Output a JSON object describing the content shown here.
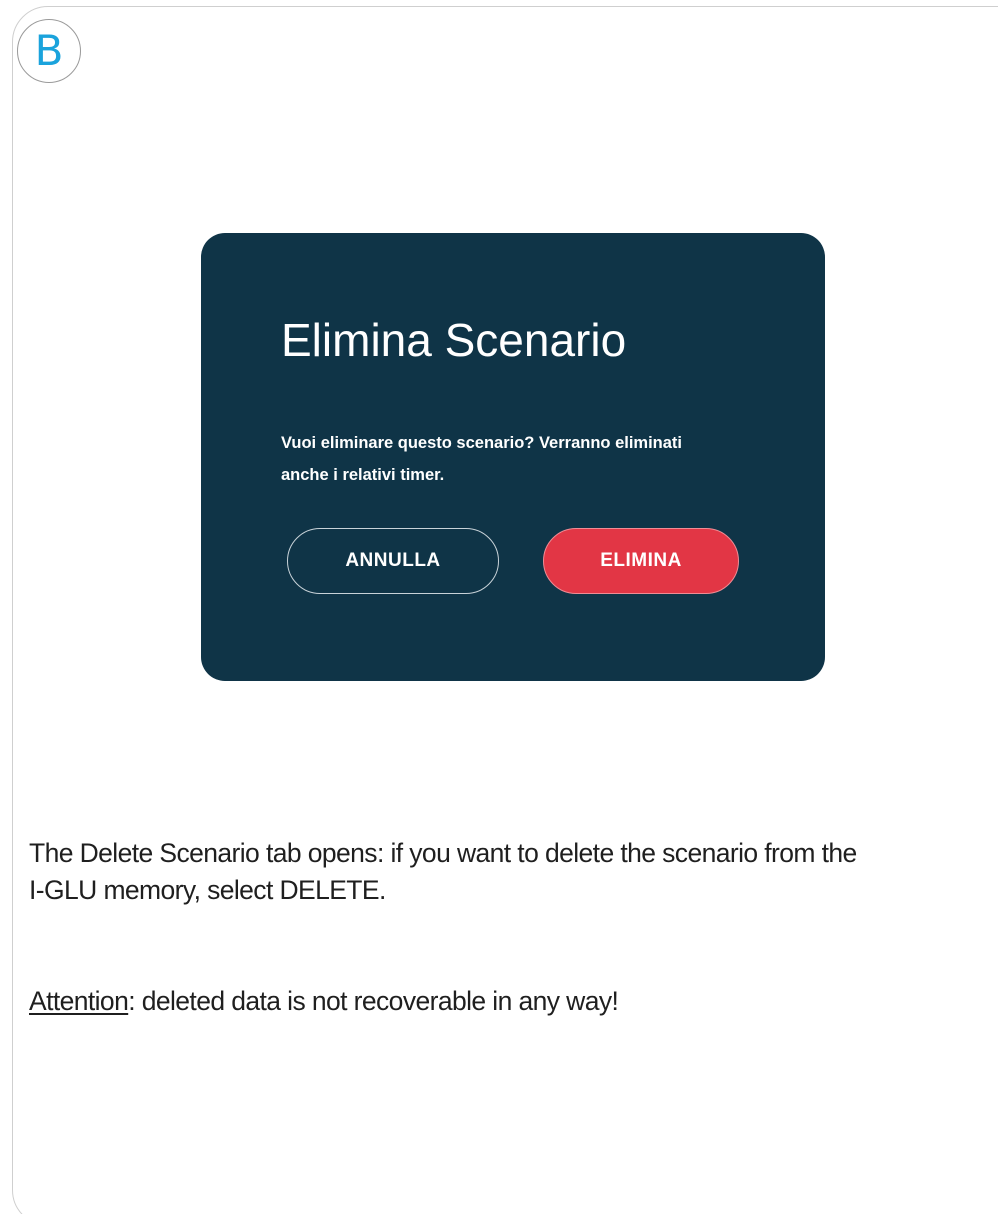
{
  "step_label": "B",
  "dialog": {
    "title": "Elimina Scenario",
    "message": "Vuoi eliminare questo scenario? Verranno eliminati anche i relativi timer.",
    "cancel_label": "ANNULLA",
    "delete_label": "ELIMINA"
  },
  "caption": {
    "line1": "The Delete Scenario tab opens: if you want to delete the scenario from the",
    "line2": "I-GLU memory, select DELETE."
  },
  "note": {
    "label": "Attention",
    "separator": ":",
    "text": " deleted data is not recoverable in any way!"
  },
  "colors": {
    "dialog_background": "#0f3447",
    "delete_button": "#e23645",
    "step_label": "#1aa3dc"
  }
}
